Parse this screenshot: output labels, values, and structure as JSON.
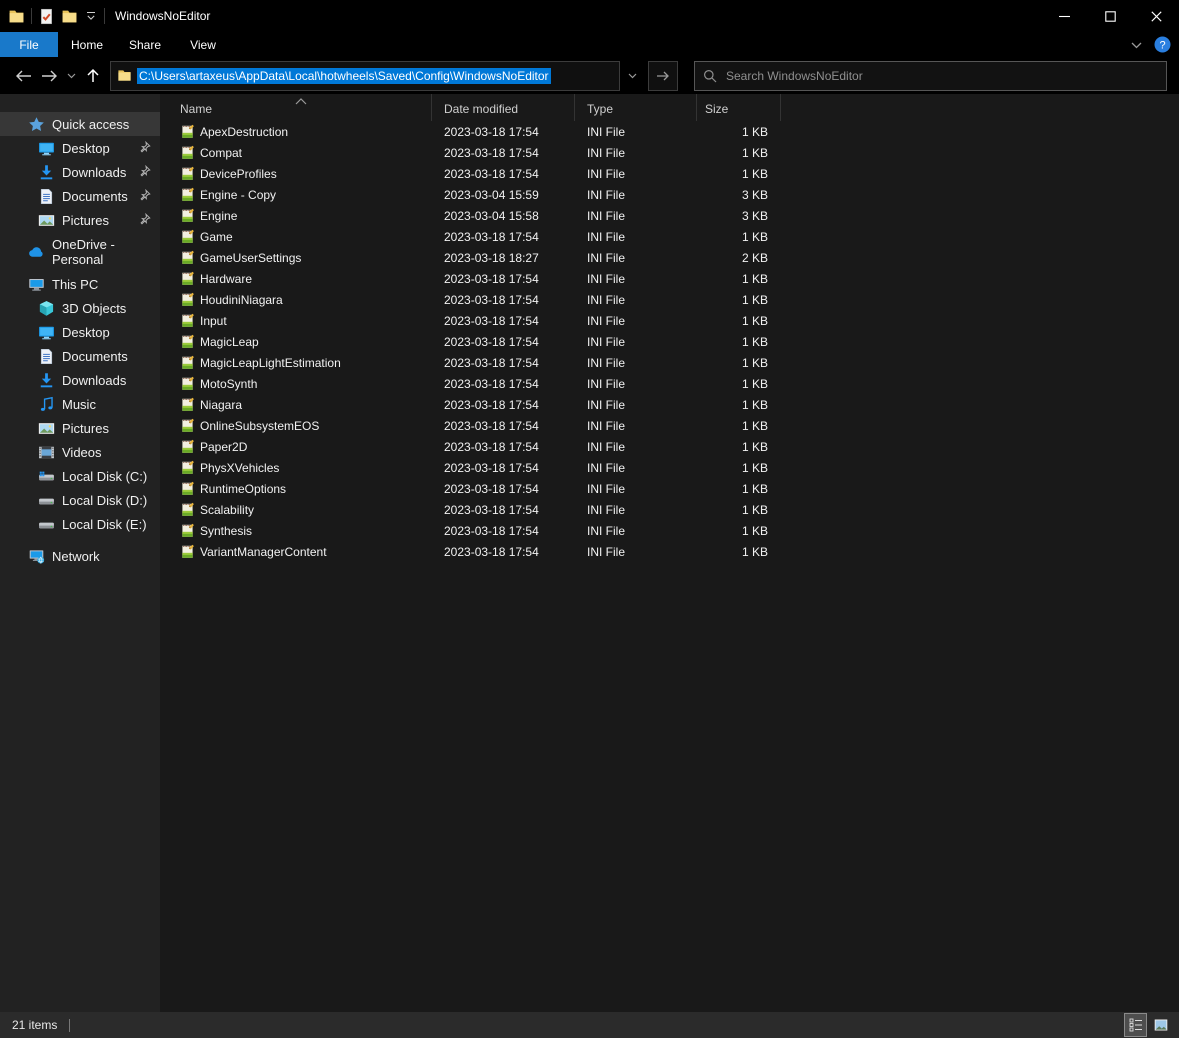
{
  "window": {
    "title": "WindowsNoEditor"
  },
  "titlebar": {
    "qat_icons": [
      "app-folder-icon",
      "properties-check-icon",
      "new-folder-icon",
      "customize-qat-chevron"
    ]
  },
  "ribbon": {
    "tabs": [
      {
        "label": "File",
        "active": true
      },
      {
        "label": "Home",
        "active": false
      },
      {
        "label": "Share",
        "active": false
      },
      {
        "label": "View",
        "active": false
      }
    ]
  },
  "address": {
    "path": "C:\\Users\\artaxeus\\AppData\\Local\\hotwheels\\Saved\\Config\\WindowsNoEditor"
  },
  "search": {
    "placeholder": "Search WindowsNoEditor"
  },
  "glyphs": {
    "back": "←",
    "forward": "→",
    "up": "↑"
  },
  "colors": {
    "accent_tab": "#1979ca",
    "selection": "#0078d7",
    "sidebar_bg": "#222222",
    "pane_bg": "#191919",
    "statusbar_bg": "#2b2b2b"
  },
  "sidebar": {
    "items": [
      {
        "label": "Quick access",
        "icon": "star",
        "level": 0,
        "selected": true
      },
      {
        "label": "Desktop",
        "icon": "desktop",
        "level": 1,
        "pinned": true
      },
      {
        "label": "Downloads",
        "icon": "download",
        "level": 1,
        "pinned": true
      },
      {
        "label": "Documents",
        "icon": "document",
        "level": 1,
        "pinned": true
      },
      {
        "label": "Pictures",
        "icon": "pictures",
        "level": 1,
        "pinned": true
      },
      {
        "label": "OneDrive - Personal",
        "icon": "cloud",
        "level": 0,
        "gap": true
      },
      {
        "label": "This PC",
        "icon": "pc",
        "level": 0,
        "gap": true
      },
      {
        "label": "3D Objects",
        "icon": "cube",
        "level": 1
      },
      {
        "label": "Desktop",
        "icon": "desktop",
        "level": 1
      },
      {
        "label": "Documents",
        "icon": "document",
        "level": 1
      },
      {
        "label": "Downloads",
        "icon": "download",
        "level": 1
      },
      {
        "label": "Music",
        "icon": "music",
        "level": 1
      },
      {
        "label": "Pictures",
        "icon": "pictures",
        "level": 1
      },
      {
        "label": "Videos",
        "icon": "videos",
        "level": 1
      },
      {
        "label": "Local Disk (C:)",
        "icon": "disk-os",
        "level": 1
      },
      {
        "label": "Local Disk (D:)",
        "icon": "disk",
        "level": 1
      },
      {
        "label": "Local Disk (E:)",
        "icon": "disk",
        "level": 1
      },
      {
        "label": "Network",
        "icon": "network",
        "level": 0,
        "gap": true
      }
    ]
  },
  "files": {
    "columns": {
      "name": "Name",
      "date": "Date modified",
      "type": "Type",
      "size": "Size"
    },
    "sort": {
      "column": "name",
      "direction": "ascending"
    },
    "rows": [
      {
        "icon": "ini",
        "name": "ApexDestruction",
        "date": "2023-03-18 17:54",
        "type": "INI File",
        "size": "1 KB"
      },
      {
        "icon": "ini",
        "name": "Compat",
        "date": "2023-03-18 17:54",
        "type": "INI File",
        "size": "1 KB"
      },
      {
        "icon": "ini",
        "name": "DeviceProfiles",
        "date": "2023-03-18 17:54",
        "type": "INI File",
        "size": "1 KB"
      },
      {
        "icon": "ini",
        "name": "Engine - Copy",
        "date": "2023-03-04 15:59",
        "type": "INI File",
        "size": "3 KB"
      },
      {
        "icon": "ini",
        "name": "Engine",
        "date": "2023-03-04 15:58",
        "type": "INI File",
        "size": "3 KB"
      },
      {
        "icon": "ini",
        "name": "Game",
        "date": "2023-03-18 17:54",
        "type": "INI File",
        "size": "1 KB"
      },
      {
        "icon": "ini",
        "name": "GameUserSettings",
        "date": "2023-03-18 18:27",
        "type": "INI File",
        "size": "2 KB"
      },
      {
        "icon": "ini",
        "name": "Hardware",
        "date": "2023-03-18 17:54",
        "type": "INI File",
        "size": "1 KB"
      },
      {
        "icon": "ini",
        "name": "HoudiniNiagara",
        "date": "2023-03-18 17:54",
        "type": "INI File",
        "size": "1 KB"
      },
      {
        "icon": "ini",
        "name": "Input",
        "date": "2023-03-18 17:54",
        "type": "INI File",
        "size": "1 KB"
      },
      {
        "icon": "ini",
        "name": "MagicLeap",
        "date": "2023-03-18 17:54",
        "type": "INI File",
        "size": "1 KB"
      },
      {
        "icon": "ini",
        "name": "MagicLeapLightEstimation",
        "date": "2023-03-18 17:54",
        "type": "INI File",
        "size": "1 KB"
      },
      {
        "icon": "ini",
        "name": "MotoSynth",
        "date": "2023-03-18 17:54",
        "type": "INI File",
        "size": "1 KB"
      },
      {
        "icon": "ini",
        "name": "Niagara",
        "date": "2023-03-18 17:54",
        "type": "INI File",
        "size": "1 KB"
      },
      {
        "icon": "ini",
        "name": "OnlineSubsystemEOS",
        "date": "2023-03-18 17:54",
        "type": "INI File",
        "size": "1 KB"
      },
      {
        "icon": "ini",
        "name": "Paper2D",
        "date": "2023-03-18 17:54",
        "type": "INI File",
        "size": "1 KB"
      },
      {
        "icon": "ini",
        "name": "PhysXVehicles",
        "date": "2023-03-18 17:54",
        "type": "INI File",
        "size": "1 KB"
      },
      {
        "icon": "ini",
        "name": "RuntimeOptions",
        "date": "2023-03-18 17:54",
        "type": "INI File",
        "size": "1 KB"
      },
      {
        "icon": "ini",
        "name": "Scalability",
        "date": "2023-03-18 17:54",
        "type": "INI File",
        "size": "1 KB"
      },
      {
        "icon": "ini",
        "name": "Synthesis",
        "date": "2023-03-18 17:54",
        "type": "INI File",
        "size": "1 KB"
      },
      {
        "icon": "ini",
        "name": "VariantManagerContent",
        "date": "2023-03-18 17:54",
        "type": "INI File",
        "size": "1 KB"
      }
    ]
  },
  "statusbar": {
    "items_count": "21 items"
  }
}
